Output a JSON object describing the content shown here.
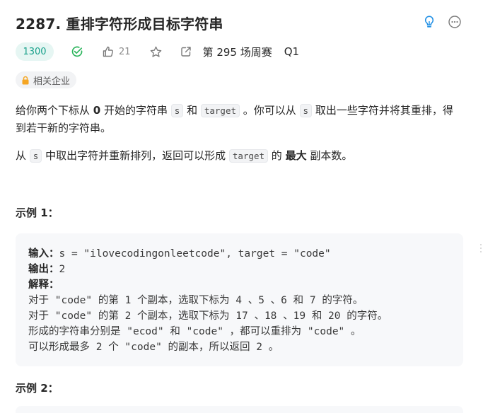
{
  "problem": {
    "title": "2287. 重排字符形成目标字符串",
    "difficulty": "1300",
    "likes": "21",
    "contest": "第 295 场周赛",
    "contest_q": "Q1",
    "company_tag": "相关企业"
  },
  "description": {
    "p1": {
      "a": "给你两个下标从 ",
      "b": "0",
      "c": " 开始的字符串 ",
      "s": "s",
      "d": " 和 ",
      "target": "target",
      "e": " 。你可以从 ",
      "s2": "s",
      "f": " 取出一些字符并将其重排，得",
      "g": "到若干新的字符串。"
    },
    "p2": {
      "a": "从 ",
      "s": "s",
      "b": " 中取出字符并重新排列，返回可以形成 ",
      "target": "target",
      "c": " 的 ",
      "bold": "最大",
      "d": " 副本数。"
    }
  },
  "example1": {
    "title": "示例 1：",
    "input_label": "输入：",
    "input_value": "s = \"ilovecodingonleetcode\", target = \"code\"",
    "output_label": "输出：",
    "output_value": "2",
    "explain_label": "解释：",
    "lines": [
      "对于 \"code\" 的第 1 个副本，选取下标为 4 、5 、6 和 7 的字符。",
      "对于 \"code\" 的第 2 个副本，选取下标为 17 、18 、19 和 20 的字符。",
      "形成的字符串分别是 \"ecod\" 和 \"code\" ，都可以重排为 \"code\" 。",
      "可以形成最多 2 个 \"code\" 的副本，所以返回 2 。"
    ]
  },
  "example2": {
    "title": "示例 2："
  },
  "colors": {
    "accent": "#17a08a",
    "badge_bg": "#e6f6f3",
    "hint_icon": "#1f8fe5",
    "company_icon": "#f5a623",
    "code_bg": "#f7f8fa"
  }
}
